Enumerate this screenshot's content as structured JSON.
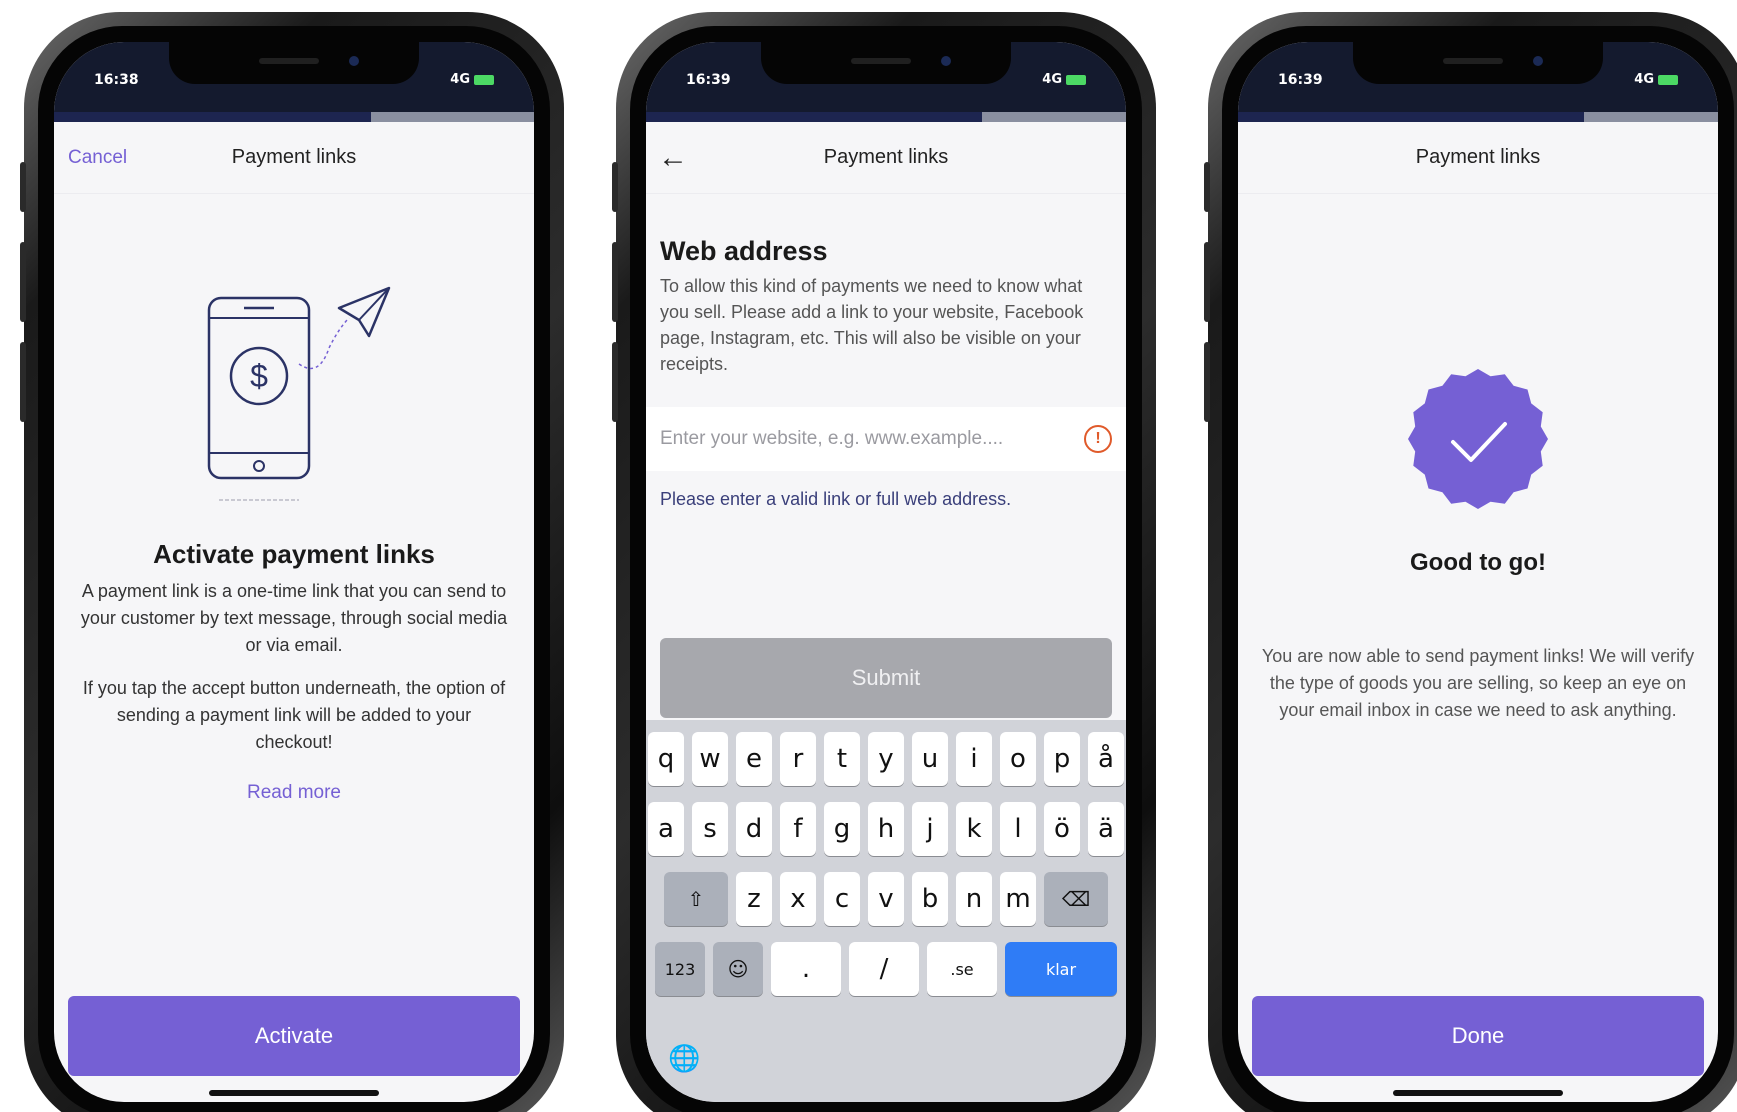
{
  "status": {
    "time": "16:38",
    "time2": "16:39",
    "time3": "16:39",
    "network": "4G"
  },
  "colors": {
    "accent": "#7560d4",
    "error": "#e05a2a",
    "submit_disabled": "#a7a8ad",
    "keyboard_done": "#2f7cf6"
  },
  "screen1": {
    "cancel": "Cancel",
    "title": "Payment links",
    "heading": "Activate payment links",
    "para1": "A payment link is a one-time link that you can send to your customer by text message, through social media or via email.",
    "para2": "If you tap the accept button underneath, the option of sending a payment link will be added to your checkout!",
    "read_more": "Read more",
    "activate": "Activate",
    "icons": {
      "illustration": "phone-dollar-paper-plane"
    }
  },
  "screen2": {
    "title": "Payment links",
    "heading": "Web address",
    "description": "To allow this kind of payments we need to know what you sell. Please add a link to your website, Facebook page, Instagram, etc. This will also be visible on your receipts.",
    "input_placeholder": "Enter your website, e.g. www.example....",
    "error": "Please enter a valid link or full web address.",
    "submit": "Submit",
    "keyboard": {
      "row1": [
        "q",
        "w",
        "e",
        "r",
        "t",
        "y",
        "u",
        "i",
        "o",
        "p",
        "å"
      ],
      "row2": [
        "a",
        "s",
        "d",
        "f",
        "g",
        "h",
        "j",
        "k",
        "l",
        "ö",
        "ä"
      ],
      "row3": [
        "z",
        "x",
        "c",
        "v",
        "b",
        "n",
        "m"
      ],
      "num": "123",
      "dot": ".",
      "slash": "/",
      "se": ".se",
      "done": "klar"
    }
  },
  "screen3": {
    "title": "Payment links",
    "heading": "Good to go!",
    "description": "You are now able to send payment links! We will verify the type of goods you are selling, so keep an eye on your email inbox in case we need to ask anything.",
    "done": "Done"
  }
}
